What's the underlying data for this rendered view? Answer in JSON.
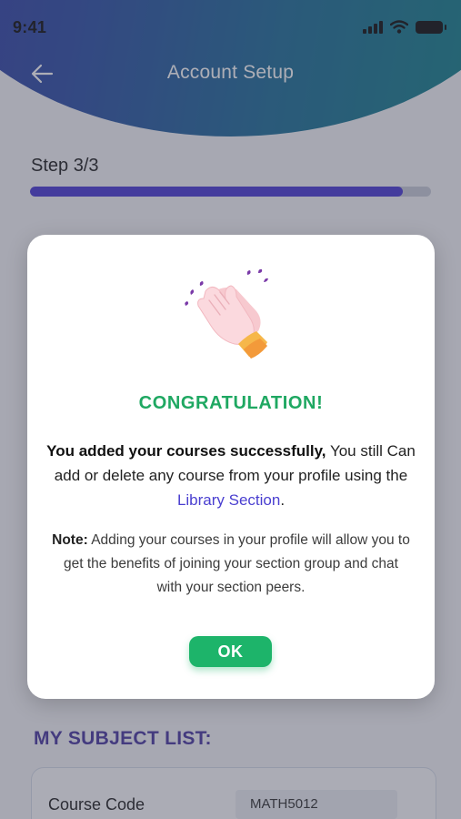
{
  "status_bar": {
    "time": "9:41"
  },
  "header": {
    "title": "Account Setup",
    "back_icon": "arrow-left-icon"
  },
  "progress": {
    "step_label": "Step 3/3",
    "fraction": 0.93,
    "color": "#4b3bd4"
  },
  "modal": {
    "icon": "clapping-hands-icon",
    "heading": "CONGRATULATION!",
    "message_bold": "You added your courses successfully,",
    "message_text": " You still Can  add or delete any course from your profile using the ",
    "message_link": "Library Section",
    "message_end": ".",
    "note_label": "Note:",
    "note_text": " Adding your courses in your profile will allow you to get the benefits of joining your section group and chat with your section peers.",
    "ok_label": "OK",
    "heading_color": "#1fa862",
    "button_color": "#1db46a"
  },
  "subject_list": {
    "heading": "MY SUBJECT LIST:",
    "course_code_label": "Course Code",
    "course_code_value": "MATH5012"
  }
}
